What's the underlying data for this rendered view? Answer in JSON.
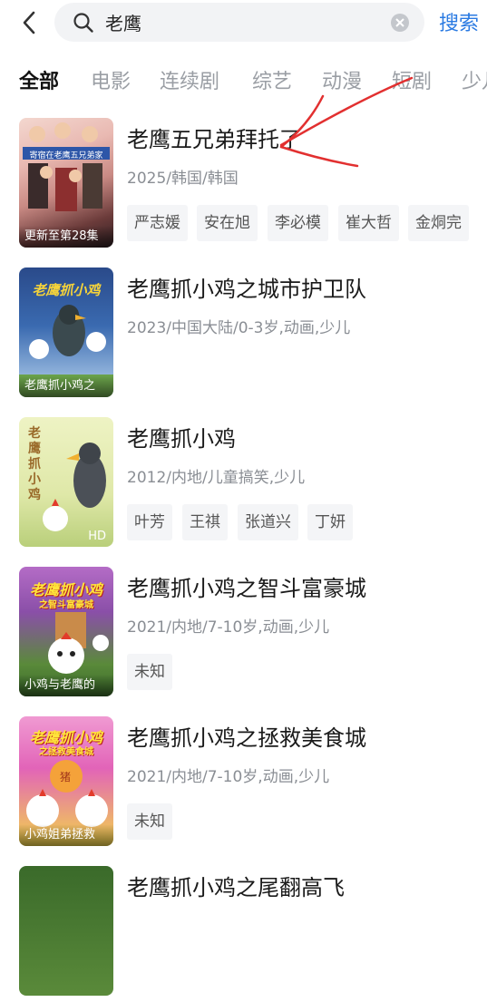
{
  "search": {
    "query": "老鹰",
    "button_label": "搜索"
  },
  "tabs": [
    "全部",
    "电影",
    "连续剧",
    "综艺",
    "动漫",
    "短剧",
    "少儿"
  ],
  "results": [
    {
      "title": "老鹰五兄弟拜托了",
      "meta": "2025/韩国/韩国",
      "poster_caption": "更新至第28集",
      "poster_banner": "寄宿在老鹰五兄弟家",
      "tags": [
        "严志媛",
        "安在旭",
        "李必模",
        "崔大哲",
        "金烔完"
      ]
    },
    {
      "title": "老鹰抓小鸡之城市护卫队",
      "meta": "2023/中国大陆/0-3岁,动画,少儿",
      "poster_caption": "老鹰抓小鸡之",
      "poster_art": "老鹰抓小鸡",
      "tags": []
    },
    {
      "title": "老鹰抓小鸡",
      "meta": "2012/内地/儿童搞笑,少儿",
      "poster_caption": "",
      "poster_badge": "HD",
      "poster_art": "老鹰抓小鸡",
      "tags": [
        "叶芳",
        "王祺",
        "张道兴",
        "丁妍"
      ]
    },
    {
      "title": "老鹰抓小鸡之智斗富豪城",
      "meta": "2021/内地/7-10岁,动画,少儿",
      "poster_caption": "小鸡与老鹰的",
      "poster_art": "老鹰抓小鸡",
      "poster_subart": "之智斗富豪城",
      "tags": [
        "未知"
      ]
    },
    {
      "title": "老鹰抓小鸡之拯救美食城",
      "meta": "2021/内地/7-10岁,动画,少儿",
      "poster_caption": "小鸡姐弟拯救",
      "poster_art": "老鹰抓小鸡",
      "poster_subart": "之拯救美食城",
      "tags": [
        "未知"
      ]
    },
    {
      "title": "老鹰抓小鸡之尾翻高飞",
      "meta": "",
      "poster_caption": "",
      "tags": []
    }
  ]
}
